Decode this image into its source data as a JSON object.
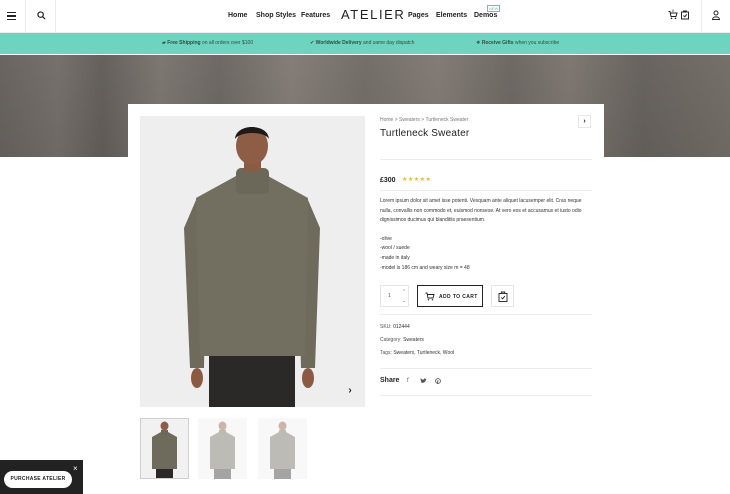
{
  "header": {
    "logo": "ATELIER",
    "nav": [
      "Home",
      "Shop Styles",
      "Features",
      "Pages",
      "Elements",
      "Demos"
    ],
    "new_badge": "NEW",
    "cart_count": "0"
  },
  "promo": {
    "items": [
      {
        "bold": "Free Shipping",
        "text": " on all orders over $100"
      },
      {
        "bold": "Worldwide Delivery",
        "text": " and same day dispatch"
      },
      {
        "bold": "Receive Gifts",
        "text": " when you subscribe"
      }
    ]
  },
  "product": {
    "breadcrumb": "Home > Sweaters > Turtleneck Sweater",
    "title": "Turtleneck Sweater",
    "price": "£300",
    "stars": "★★★★★",
    "description": "Lorem ipsum dolor sit amet isse potenti. Vesquam ante aliquet lacusemper elit. Cras neque nulla, convallis non commodo et, euismod nonsese. At vero eos et accusamus et iusto odio dignissimos ducimus qui blanditiis praesentium.",
    "features": [
      "-olive",
      "-wool / suede",
      "-made in italy",
      "-model is 186 cm and weary size m = 48"
    ],
    "quantity": "1",
    "add_to_cart": "ADD TO CART",
    "sku_label": "SKU:",
    "sku": "012444",
    "category_label": "Category:",
    "category": "Sweaters",
    "tags_label": "Tags:",
    "tags": "Sweaters, Turtleneck, Wool",
    "share_label": "Share"
  },
  "purchase": {
    "label": "PURCHASE ATELIER"
  },
  "colors": {
    "promo_bg": "#6ed4bf",
    "star": "#e6b82a",
    "sweater": "#6e6b5c"
  }
}
